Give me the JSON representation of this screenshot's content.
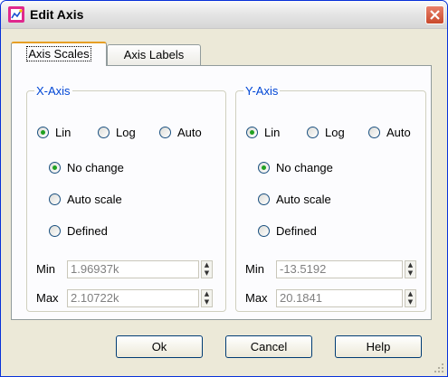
{
  "window": {
    "title": "Edit Axis",
    "icon": "chart-icon",
    "close_icon": "close-icon",
    "title_color": "#000000",
    "accent": "#e69e24"
  },
  "tabs": [
    {
      "label": "Axis Scales",
      "selected": true
    },
    {
      "label": "Axis Labels",
      "selected": false
    }
  ],
  "x_axis": {
    "legend": "X-Axis",
    "scale": {
      "lin": "Lin",
      "log": "Log",
      "auto": "Auto",
      "selected": "Lin"
    },
    "mode": {
      "no_change": "No change",
      "auto_scale": "Auto scale",
      "defined": "Defined",
      "selected": "No change"
    },
    "min_label": "Min",
    "min_value": "1.96937k",
    "max_label": "Max",
    "max_value": "2.10722k"
  },
  "y_axis": {
    "legend": "Y-Axis",
    "scale": {
      "lin": "Lin",
      "log": "Log",
      "auto": "Auto",
      "selected": "Lin"
    },
    "mode": {
      "no_change": "No change",
      "auto_scale": "Auto scale",
      "defined": "Defined",
      "selected": "No change"
    },
    "min_label": "Min",
    "min_value": "-13.5192",
    "max_label": "Max",
    "max_value": "20.1841"
  },
  "buttons": {
    "ok": "Ok",
    "cancel": "Cancel",
    "help": "Help"
  }
}
